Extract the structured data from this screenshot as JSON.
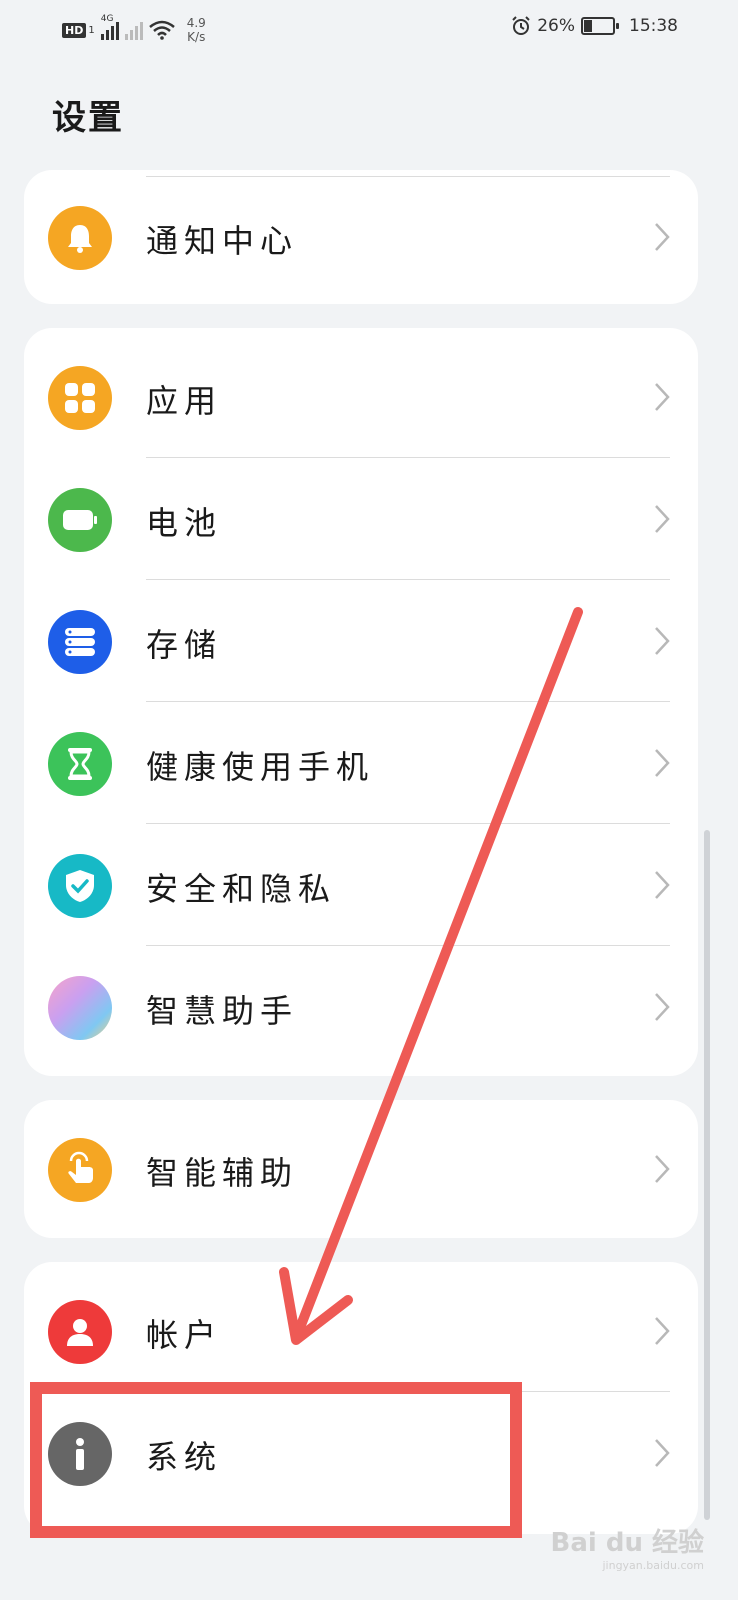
{
  "status_bar": {
    "hd": "HD",
    "sim": "1",
    "network": "4G",
    "speed_value": "4.9",
    "speed_unit": "K/s",
    "battery": "26%",
    "time": "15:38"
  },
  "page": {
    "title": "设置"
  },
  "groups": [
    {
      "items": [
        {
          "label": "通知中心",
          "icon": "bell-icon",
          "color": "#f5a623"
        }
      ]
    },
    {
      "items": [
        {
          "label": "应用",
          "icon": "apps-grid-icon",
          "color": "#f5a623"
        },
        {
          "label": "电池",
          "icon": "battery-icon",
          "color": "#4cb84c"
        },
        {
          "label": "存储",
          "icon": "storage-icon",
          "color": "#1e5ee8"
        },
        {
          "label": "健康使用手机",
          "icon": "hourglass-icon",
          "color": "#3cc35a"
        },
        {
          "label": "安全和隐私",
          "icon": "shield-check-icon",
          "color": "#17b9c6"
        },
        {
          "label": "智慧助手",
          "icon": "smart-assistant-icon",
          "color": "#e98bd7"
        }
      ]
    },
    {
      "items": [
        {
          "label": "智能辅助",
          "icon": "hand-tap-icon",
          "color": "#f5a623"
        }
      ]
    },
    {
      "items": [
        {
          "label": "帐户",
          "icon": "person-icon",
          "color": "#ee3a3a"
        },
        {
          "label": "系统",
          "icon": "info-icon",
          "color": "#666666"
        }
      ]
    }
  ],
  "annotation": {
    "color": "#ee5a55"
  },
  "watermark": {
    "text": "Bai du 经验",
    "sub": "jingyan.baidu.com"
  }
}
